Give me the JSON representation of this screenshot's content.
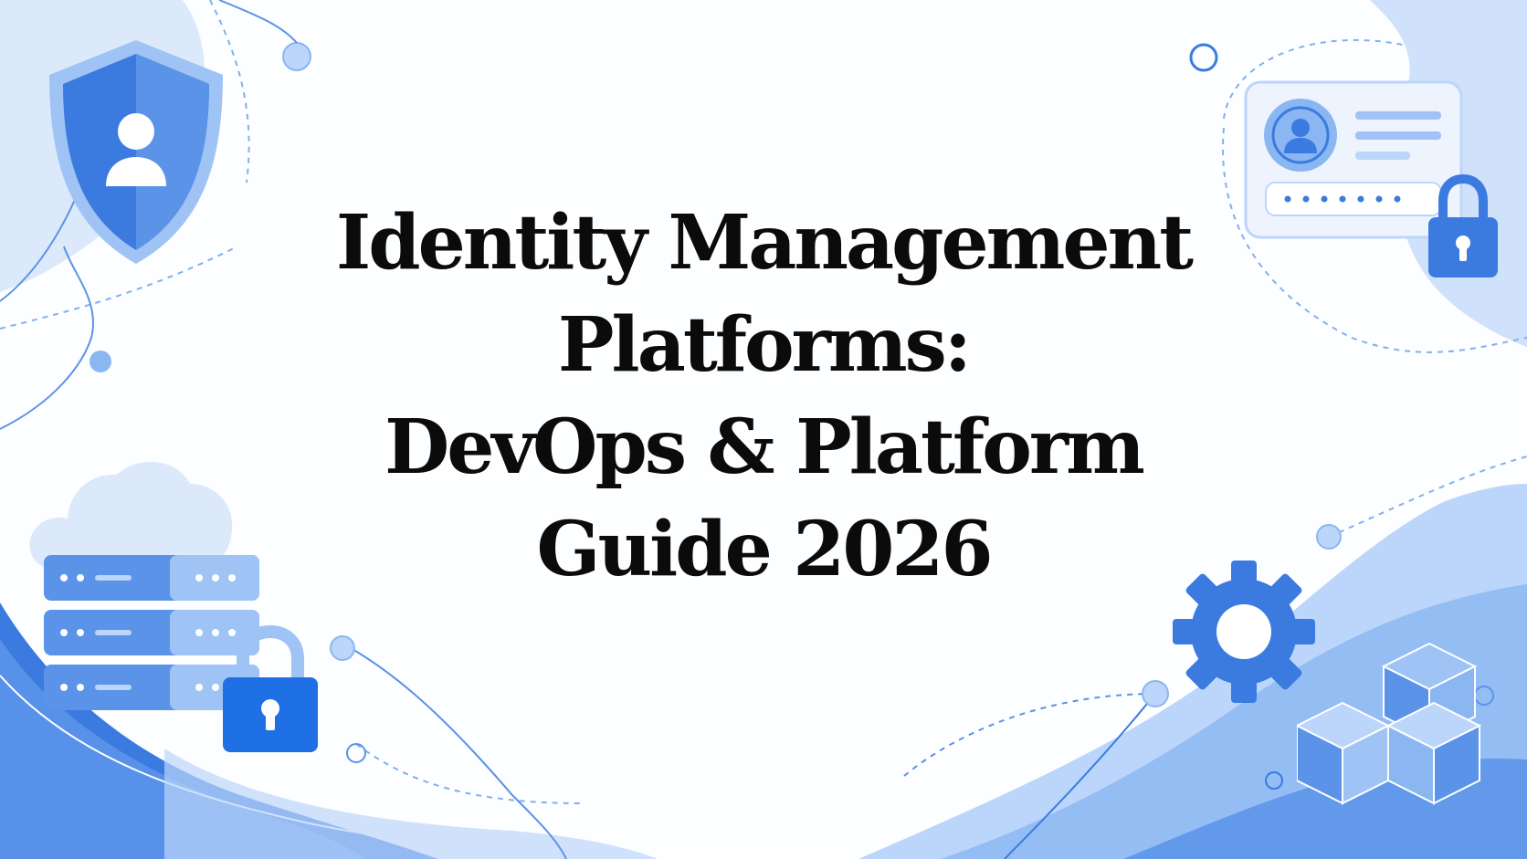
{
  "title": {
    "lines": [
      "Identity Management",
      "Platforms:",
      "DevOps & Platform",
      "Guide 2026"
    ]
  },
  "icons": [
    "shield-user-icon",
    "user-id-card-icon",
    "padlock-icon",
    "cloud-icon",
    "server-rack-icon",
    "gear-icon",
    "cubes-icon"
  ],
  "colors": {
    "accent": "#3b7be0",
    "light_blue": "#bcd5fa",
    "pale_blue": "#e4eefc",
    "text": "#0b0b0b"
  }
}
